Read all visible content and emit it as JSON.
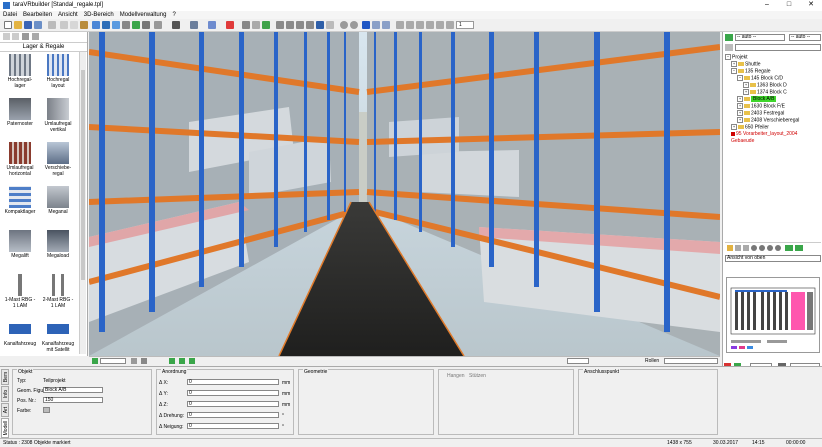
{
  "window": {
    "title": "taraVRbuilder [Standal_regale.tpl]",
    "minimize": "–",
    "maximize": "□",
    "close": "✕"
  },
  "menu": [
    "Datei",
    "Bearbeiten",
    "Ansicht",
    "3D-Bereich",
    "Modellverwaltung",
    "?"
  ],
  "toolbar": {
    "page_value": "1"
  },
  "library": {
    "title": "Lager & Regale",
    "items": [
      {
        "label": "Hochregal-\nlager"
      },
      {
        "label": "Hochregal\nlayout"
      },
      {
        "label": "Paternoster"
      },
      {
        "label": "Umlaufregal\nvertikal"
      },
      {
        "label": "Umlaufregal\nhorizontal"
      },
      {
        "label": "Verschiebe-\nregal"
      },
      {
        "label": "Kompaktlager"
      },
      {
        "label": "Meganal"
      },
      {
        "label": "Megalift"
      },
      {
        "label": "Megaload"
      },
      {
        "label": "1-Mast RBG -\n1 LAM"
      },
      {
        "label": "2-Mast RBG -\n1 LAM"
      },
      {
        "label": "Kanalfahrzeug"
      },
      {
        "label": "Kanalfahrzeug\nmit Satellit"
      }
    ]
  },
  "viewport_bar": {
    "mode": "Rollen"
  },
  "right": {
    "selects": [
      "-- auto --",
      "-- auto --"
    ],
    "tree": [
      {
        "label": "Projekt",
        "indent": 0,
        "color": "#000",
        "exp": "−",
        "folder": false
      },
      {
        "label": "Shuttle",
        "indent": 1,
        "color": "#000",
        "exp": "+",
        "folder": true
      },
      {
        "label": "135 Regale",
        "indent": 1,
        "color": "#000",
        "exp": "−",
        "folder": true
      },
      {
        "label": "145 Block C/D",
        "indent": 2,
        "color": "#000",
        "exp": "−",
        "folder": true
      },
      {
        "label": "1363 Block D",
        "indent": 3,
        "color": "#000",
        "exp": "+",
        "folder": true
      },
      {
        "label": "1374 Block C",
        "indent": 3,
        "color": "#000",
        "exp": "+",
        "folder": true
      },
      {
        "label": "Block A/B",
        "indent": 2,
        "color": "#000",
        "exp": "+",
        "folder": true,
        "selected": true
      },
      {
        "label": "1630 Block F/E",
        "indent": 2,
        "color": "#000",
        "exp": "+",
        "folder": true
      },
      {
        "label": "2403 Festregal",
        "indent": 2,
        "color": "#000",
        "exp": "+",
        "folder": true
      },
      {
        "label": "2408 Verschieberegal",
        "indent": 2,
        "color": "#000",
        "exp": "+",
        "folder": true
      },
      {
        "label": "650 Pfeiler",
        "indent": 1,
        "color": "#000",
        "exp": "+",
        "folder": true
      },
      {
        "label": "95 Vorarbeiter_layout_2004",
        "indent": 1,
        "color": "#d00000",
        "exp": "",
        "folder": false
      },
      {
        "label": "Gebaeude",
        "indent": 1,
        "color": "#d00000",
        "exp": "",
        "folder": false
      }
    ],
    "view_select": "Ansicht von oben"
  },
  "bottom": {
    "tabs": [
      "Bem",
      "Info",
      "Art",
      "Modell"
    ],
    "objekt": {
      "title": "Objekt",
      "typ_label": "Typ:",
      "typ_value": "Teilprojekt",
      "geom_label": "Geom. Figur:",
      "geom_value": "Block A/B",
      "pos_label": "Pos. Nr.:",
      "pos_value": "150",
      "farbe_label": "Farbe:"
    },
    "anordnung": {
      "title": "Anordnung",
      "rows": [
        {
          "label": "Δ X:",
          "value": "0",
          "unit": "mm"
        },
        {
          "label": "Δ Y:",
          "value": "0",
          "unit": "mm"
        },
        {
          "label": "Δ Z:",
          "value": "0",
          "unit": "mm"
        },
        {
          "label": "Δ Drehung:",
          "value": "0",
          "unit": "°"
        },
        {
          "label": "Δ Neigung:",
          "value": "0",
          "unit": "°"
        }
      ]
    },
    "geometrie": {
      "title": "Geometrie"
    },
    "haengen": {
      "tab1": "Hangen",
      "tab2": "Stützen"
    },
    "anschluss": {
      "title": "Anschlusspunkt"
    }
  },
  "status": {
    "left": "Status : 2308 Objekte markiert",
    "size": "1438 x 755",
    "date": "30.03.2017",
    "time": "14:15",
    "timer": "00:00:00"
  }
}
